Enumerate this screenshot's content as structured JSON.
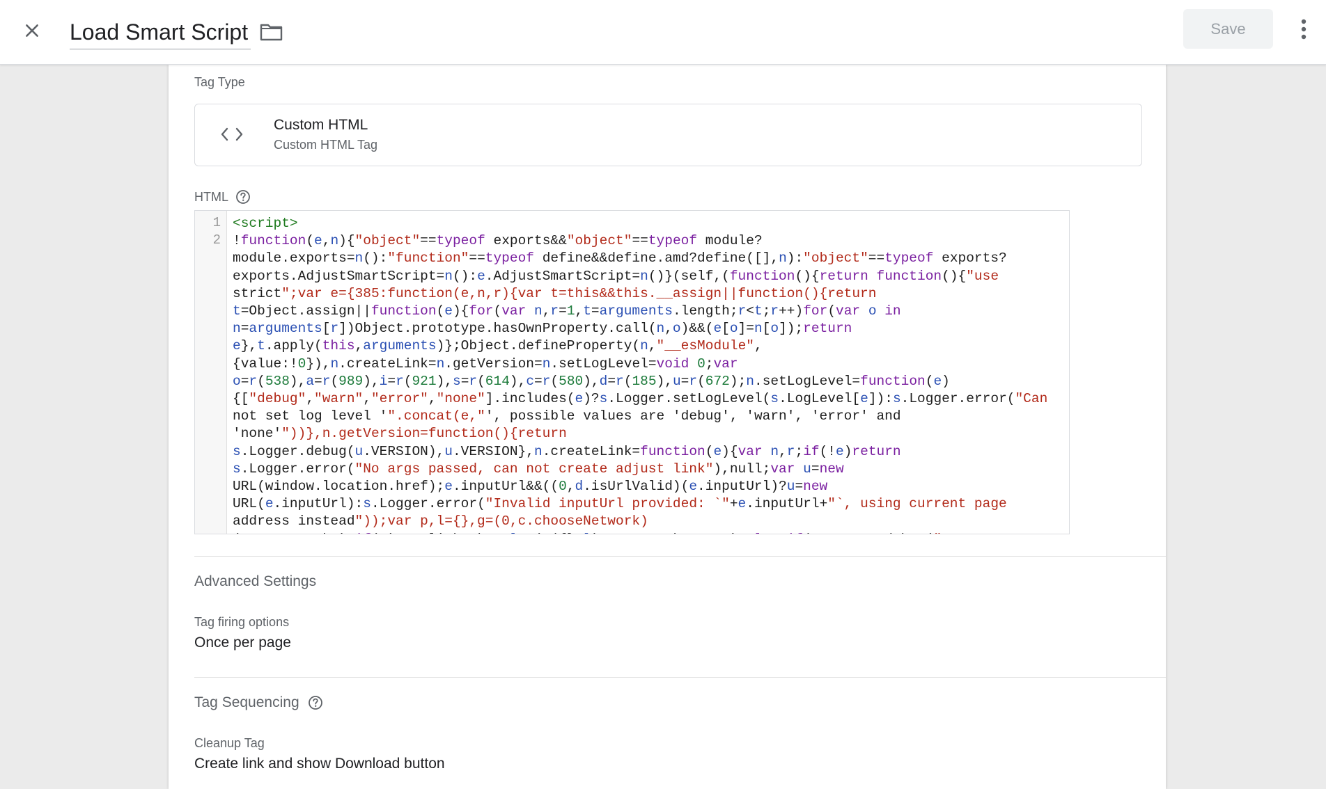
{
  "header": {
    "title": "Load Smart Script",
    "save_label": "Save"
  },
  "tag_type": {
    "section_label": "Tag Type",
    "name": "Custom HTML",
    "description": "Custom HTML Tag",
    "icon": "code-brackets-icon"
  },
  "html_field": {
    "label": "HTML",
    "line_numbers": [
      "1",
      "2"
    ],
    "code_lines": [
      "<script>",
      "!function(e,n){\"object\"==typeof exports&&\"object\"==typeof module?",
      "module.exports=n():\"function\"==typeof define&&define.amd?define([],n):\"object\"==typeof exports?",
      "exports.AdjustSmartScript=n():e.AdjustSmartScript=n()}(self,(function(){return function(){\"use",
      "strict\";var e={385:function(e,n,r){var t=this&&this.__assign||function(){return",
      "t=Object.assign||function(e){for(var n,r=1,t=arguments.length;r<t;r++)for(var o in",
      "n=arguments[r])Object.prototype.hasOwnProperty.call(n,o)&&(e[o]=n[o]);return",
      "e},t.apply(this,arguments)};Object.defineProperty(n,\"__esModule\",",
      "{value:!0}),n.createLink=n.getVersion=n.setLogLevel=void 0;var",
      "o=r(538),a=r(989),i=r(921),s=r(614),c=r(580),d=r(185),u=r(672);n.setLogLevel=function(e)",
      "{[\"debug\",\"warn\",\"error\",\"none\"].includes(e)?s.Logger.setLogLevel(s.LogLevel[e]):s.Logger.error(\"Can",
      "not set log level '\".concat(e,\"', possible values are 'debug', 'warn', 'error' and",
      "'none'\"))},n.getVersion=function(){return",
      "s.Logger.debug(u.VERSION),u.VERSION},n.createLink=function(e){var n,r;if(!e)return",
      "s.Logger.error(\"No args passed, can not create adjust link\"),null;var u=new",
      "URL(window.location.href);e.inputUrl&&((0,d.isUrlValid)(e.inputUrl)?u=new",
      "URL(e.inputUrl):s.Logger.error(\"Invalid inputUrl provided: `\"+e.inputUrl+\"`, using current page",
      "address instead\"));var p,l={},g=(0,c.chooseNetwork)",
      "(u,o.networks);if(g)p=g.linkToken,l=t(t({},l),g.networkParams);else if(s.Logger.debug(\"Use"
    ]
  },
  "advanced_settings": {
    "title": "Advanced Settings",
    "firing_label": "Tag firing options",
    "firing_value": "Once per page"
  },
  "tag_sequencing": {
    "title": "Tag Sequencing",
    "cleanup_label": "Cleanup Tag",
    "cleanup_value": "Create link and show Download button"
  }
}
